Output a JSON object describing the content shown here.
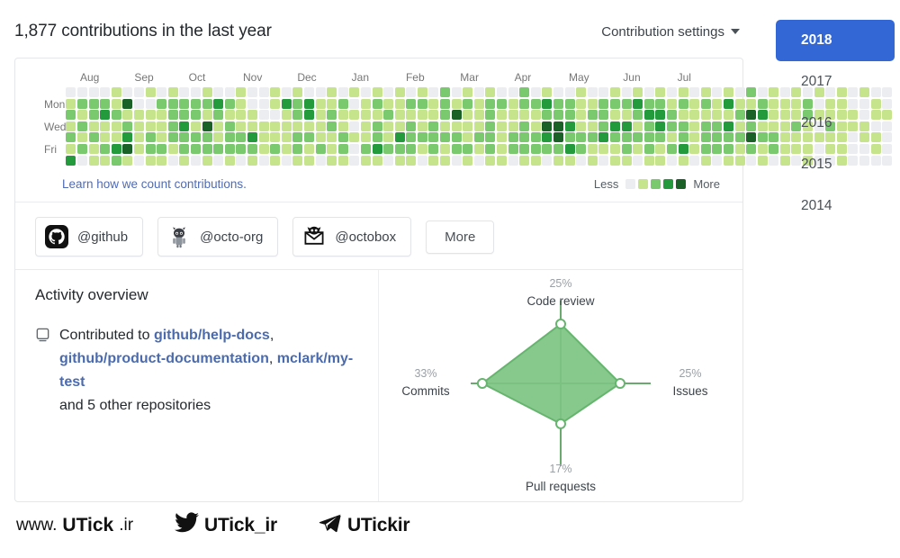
{
  "header": {
    "title": "1,877 contributions in the last year",
    "settings_label": "Contribution settings",
    "caret_icon": "chevron-down-icon"
  },
  "calendar": {
    "months": [
      "Aug",
      "Sep",
      "Oct",
      "Nov",
      "Dec",
      "Jan",
      "Feb",
      "Mar",
      "Apr",
      "May",
      "Jun",
      "Jul"
    ],
    "day_labels": [
      "",
      "Mon",
      "",
      "Wed",
      "",
      "Fri",
      ""
    ],
    "learn_link": "Learn how we count contributions.",
    "legend": {
      "less": "Less",
      "more": "More",
      "colors": [
        "#ebedf0",
        "#c6e48b",
        "#7bc96f",
        "#239a3b",
        "#196127"
      ]
    },
    "levels": [
      [
        0,
        1,
        2,
        1,
        2,
        1,
        3
      ],
      [
        0,
        2,
        1,
        2,
        1,
        2,
        0
      ],
      [
        0,
        2,
        2,
        1,
        2,
        1,
        1
      ],
      [
        0,
        2,
        3,
        1,
        1,
        2,
        1
      ],
      [
        1,
        1,
        2,
        1,
        1,
        3,
        2
      ],
      [
        0,
        4,
        1,
        2,
        3,
        4,
        1
      ],
      [
        0,
        0,
        1,
        1,
        1,
        1,
        0
      ],
      [
        1,
        0,
        1,
        1,
        2,
        2,
        1
      ],
      [
        0,
        2,
        1,
        1,
        1,
        2,
        1
      ],
      [
        1,
        2,
        2,
        2,
        2,
        1,
        0
      ],
      [
        0,
        2,
        2,
        3,
        2,
        2,
        1
      ],
      [
        0,
        2,
        2,
        1,
        2,
        2,
        0
      ],
      [
        1,
        2,
        1,
        4,
        2,
        2,
        1
      ],
      [
        0,
        3,
        2,
        1,
        1,
        2,
        0
      ],
      [
        0,
        2,
        1,
        2,
        2,
        2,
        1
      ],
      [
        1,
        1,
        1,
        1,
        2,
        2,
        0
      ],
      [
        0,
        0,
        1,
        1,
        3,
        2,
        1
      ],
      [
        0,
        0,
        0,
        1,
        1,
        1,
        0
      ],
      [
        1,
        1,
        0,
        1,
        1,
        2,
        1
      ],
      [
        0,
        3,
        1,
        1,
        1,
        1,
        0
      ],
      [
        1,
        2,
        2,
        1,
        2,
        2,
        1
      ],
      [
        0,
        3,
        3,
        1,
        2,
        1,
        1
      ],
      [
        0,
        1,
        1,
        1,
        1,
        2,
        0
      ],
      [
        1,
        1,
        2,
        2,
        1,
        1,
        1
      ],
      [
        0,
        2,
        1,
        1,
        2,
        2,
        1
      ],
      [
        1,
        0,
        1,
        0,
        1,
        0,
        0
      ],
      [
        0,
        1,
        1,
        1,
        1,
        2,
        1
      ],
      [
        1,
        2,
        1,
        2,
        2,
        3,
        1
      ],
      [
        0,
        1,
        2,
        1,
        1,
        2,
        0
      ],
      [
        1,
        1,
        1,
        1,
        3,
        2,
        1
      ],
      [
        0,
        2,
        1,
        2,
        2,
        2,
        1
      ],
      [
        1,
        2,
        1,
        1,
        2,
        1,
        0
      ],
      [
        0,
        1,
        1,
        2,
        2,
        2,
        1
      ],
      [
        2,
        2,
        2,
        1,
        2,
        1,
        1
      ],
      [
        0,
        1,
        4,
        1,
        2,
        2,
        0
      ],
      [
        1,
        2,
        1,
        1,
        1,
        2,
        1
      ],
      [
        0,
        1,
        1,
        1,
        2,
        1,
        0
      ],
      [
        1,
        2,
        2,
        2,
        2,
        2,
        1
      ],
      [
        0,
        2,
        1,
        1,
        1,
        1,
        1
      ],
      [
        0,
        1,
        1,
        1,
        2,
        2,
        0
      ],
      [
        2,
        2,
        1,
        2,
        2,
        2,
        1
      ],
      [
        0,
        2,
        1,
        1,
        2,
        2,
        1
      ],
      [
        1,
        3,
        2,
        4,
        3,
        2,
        0
      ],
      [
        0,
        2,
        2,
        4,
        4,
        2,
        1
      ],
      [
        0,
        2,
        2,
        3,
        2,
        3,
        1
      ],
      [
        1,
        1,
        1,
        1,
        2,
        2,
        0
      ],
      [
        0,
        1,
        2,
        1,
        2,
        1,
        1
      ],
      [
        0,
        2,
        2,
        2,
        3,
        1,
        0
      ],
      [
        1,
        2,
        1,
        3,
        2,
        1,
        1
      ],
      [
        0,
        2,
        1,
        3,
        2,
        2,
        1
      ],
      [
        1,
        3,
        2,
        1,
        2,
        1,
        0
      ],
      [
        0,
        2,
        3,
        2,
        2,
        2,
        1
      ],
      [
        1,
        2,
        3,
        3,
        2,
        1,
        1
      ],
      [
        0,
        1,
        2,
        2,
        1,
        2,
        0
      ],
      [
        1,
        2,
        1,
        2,
        2,
        3,
        1
      ],
      [
        0,
        1,
        1,
        1,
        1,
        1,
        0
      ],
      [
        1,
        2,
        1,
        2,
        2,
        2,
        1
      ],
      [
        0,
        1,
        1,
        2,
        2,
        2,
        0
      ],
      [
        1,
        3,
        1,
        3,
        2,
        2,
        1
      ],
      [
        0,
        1,
        2,
        1,
        2,
        1,
        1
      ],
      [
        2,
        1,
        4,
        2,
        4,
        2,
        0
      ],
      [
        0,
        2,
        3,
        1,
        2,
        1,
        1
      ],
      [
        1,
        1,
        1,
        1,
        2,
        2,
        0
      ],
      [
        0,
        1,
        1,
        1,
        1,
        1,
        1
      ],
      [
        1,
        1,
        1,
        2,
        1,
        1,
        0
      ],
      [
        0,
        2,
        2,
        1,
        1,
        1,
        1
      ],
      [
        1,
        0,
        1,
        0,
        1,
        0,
        0
      ],
      [
        0,
        1,
        1,
        2,
        1,
        1,
        0
      ],
      [
        1,
        1,
        1,
        1,
        1,
        1,
        1
      ],
      [
        0,
        0,
        1,
        1,
        0,
        0,
        0
      ],
      [
        1,
        0,
        0,
        1,
        1,
        0,
        0
      ],
      [
        0,
        1,
        1,
        0,
        1,
        1,
        0
      ],
      [
        0,
        0,
        1,
        0,
        0,
        0,
        0
      ]
    ]
  },
  "organizations": {
    "items": [
      {
        "name": "@github",
        "icon": "octocat-mark-icon"
      },
      {
        "name": "@octo-org",
        "icon": "octocat-figure-icon"
      },
      {
        "name": "@octobox",
        "icon": "octobox-envelope-icon"
      }
    ],
    "more_label": "More"
  },
  "activity": {
    "title": "Activity overview",
    "repo_icon": "repo-book-icon",
    "contributed_prefix": "Contributed to ",
    "repos": [
      "github/help-docs",
      "github/product-documentation",
      "mclark/my-test"
    ],
    "suffix": "and 5 other repositories"
  },
  "chart_data": {
    "type": "radar",
    "title": "",
    "categories": [
      "Code review",
      "Issues",
      "Pull requests",
      "Commits"
    ],
    "values": [
      25,
      25,
      17,
      33
    ],
    "value_labels": [
      "25%",
      "25%",
      "17%",
      "33%"
    ],
    "unit": "%",
    "max": 100,
    "axes_positions": [
      "top",
      "right",
      "bottom",
      "left"
    ],
    "fill_color": "#7dc383",
    "stroke_color": "#66b56e",
    "axis_color": "#6aaa6e",
    "point_color": "#ffffff",
    "legend": "none",
    "grid": false
  },
  "years": {
    "items": [
      "2018",
      "2017",
      "2016",
      "2015",
      "2014"
    ],
    "selected": "2018",
    "active_color": "#3367d6"
  },
  "watermark": {
    "site_prefix": "www.",
    "site_bold": "UTick",
    "site_suffix": ".ir",
    "twitter_icon": "twitter-bird-icon",
    "twitter_handle": "UTick_ir",
    "telegram_icon": "telegram-plane-icon",
    "telegram_handle": "UTickir"
  }
}
